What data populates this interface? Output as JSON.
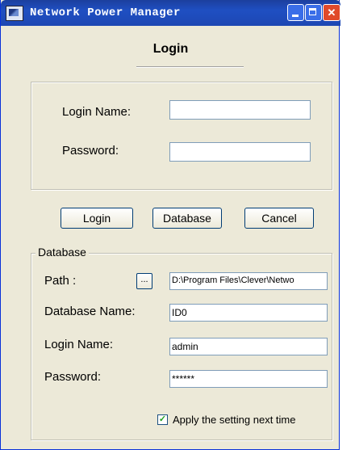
{
  "window": {
    "title": "Network Power Manager",
    "controls": [
      "minimize",
      "maximize",
      "close"
    ]
  },
  "login_section": {
    "heading": "Login",
    "login_name_label": "Login Name:",
    "login_name_value": "",
    "password_label": "Password:",
    "password_value": ""
  },
  "buttons": {
    "login": "Login",
    "database": "Database",
    "cancel": "Cancel"
  },
  "database_section": {
    "legend": "Database",
    "path_label": "Path :",
    "browse_label": "...",
    "path_value": "D:\\Program Files\\Clever\\Netwo",
    "db_name_label": "Database Name:",
    "db_name_value": "ID0",
    "login_name_label": "Login Name:",
    "login_name_value": "admin",
    "password_label": "Password:",
    "password_value": "******",
    "apply_checked": true,
    "apply_label": "Apply the setting next time"
  }
}
